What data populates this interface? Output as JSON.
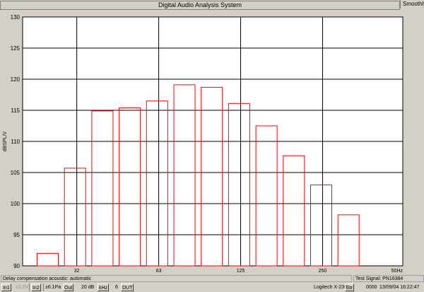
{
  "window": {
    "title": "Digital Audio Analysis System",
    "smooth_label": "Smoothly"
  },
  "chart_data": {
    "type": "bar",
    "title": "",
    "ylabel": "dBSPL/V",
    "xlabel": "",
    "ylim": [
      90,
      130
    ],
    "yticks": [
      90,
      95,
      100,
      105,
      110,
      115,
      120,
      125,
      130
    ],
    "xtick_labels": [
      "32",
      "63",
      "125",
      "250",
      "50Hz"
    ],
    "values": [
      92,
      105.7,
      114.9,
      115.4,
      116.5,
      119.1,
      118.7,
      116.1,
      112.5,
      107.7,
      103,
      98.2
    ],
    "bar_color": "#ff0000",
    "grid": true
  },
  "status": {
    "message": "Delay compensation acoustic: automatic",
    "test_signal": "Test Signal: PN16384"
  },
  "toolbar": {
    "in1": "In1",
    "level": "±2.0V",
    "in2": "In2",
    "pa": "±6.1Pa",
    "out": "Out",
    "db": "20 dB",
    "khz": "kHz",
    "num": "6",
    "dut": "DUT",
    "device": "Logitech X-230",
    "str": "Str",
    "counter": "0000",
    "datetime": "13/09/04 16:22:47"
  }
}
